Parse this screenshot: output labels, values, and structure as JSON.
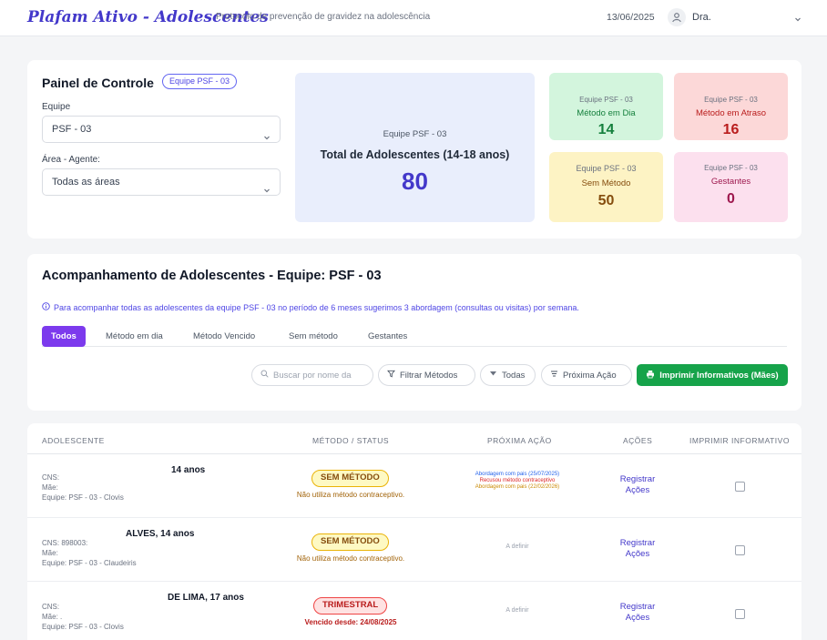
{
  "header": {
    "brand": "Plafam Ativo - Adolescentes",
    "subtitle": "Protocolo de prevenção de gravidez na adolescência",
    "date": "13/06/2025",
    "user": "Dra."
  },
  "control_panel": {
    "title": "Painel de Controle",
    "team_pill": "Equipe PSF - 03",
    "team_label": "Equipe",
    "team_value": "PSF - 03",
    "area_label": "Área - Agente:",
    "area_value": "Todas as áreas",
    "total": {
      "team": "Equipe PSF - 03",
      "label": "Total de Adolescentes (14-18 anos)",
      "value": "80"
    },
    "stats": [
      {
        "team": "Equipe PSF - 03",
        "label": "Método em Dia",
        "value": "14",
        "color": "#15803d"
      },
      {
        "team": "Equipe PSF - 03",
        "label": "Método em Atraso",
        "value": "16",
        "color": "#b91c1c"
      },
      {
        "team": "Equipe PSF - 03",
        "label": "Sem Método",
        "value": "50",
        "color": "#854d0e"
      },
      {
        "team": "Equipe PSF - 03",
        "label": "Gestantes",
        "value": "0",
        "color": "#9d174d"
      }
    ]
  },
  "tracking": {
    "title": "Acompanhamento de Adolescentes - Equipe: PSF - 03",
    "info": "Para acompanhar todas as adolescentes da equipe PSF - 03 no período de 6 meses sugerimos 3 abordagem (consultas ou visitas) por semana.",
    "tabs": [
      "Todos",
      "Método em dia",
      "Método Vencido",
      "Sem método",
      "Gestantes"
    ],
    "search_placeholder": "Buscar por nome da",
    "filter_label": "Filtrar Métodos",
    "all_label": "Todas",
    "next_action_label": "Próxima Ação",
    "print_label": "Imprimir Informativos (Mães)"
  },
  "table": {
    "columns": [
      "ADOLESCENTE",
      "MÉTODO / STATUS",
      "PRÓXIMA AÇÃO",
      "AÇÕES",
      "IMPRIMIR INFORMATIVO"
    ],
    "rows": [
      {
        "name": "14 anos",
        "cns": "CNS:",
        "mae": "Mãe:",
        "equipe": "Equipe: PSF - 03 - Clovis",
        "badge": "SEM MÉTODO",
        "status_text": "Não utiliza método contraceptivo.",
        "next_lines": [
          "Abordagem com pais (25/07/2025)",
          "Recusou método contraceptivo",
          "Abordagem com pais (22/02/2026)"
        ],
        "action": "Registrar Ações"
      },
      {
        "name": "ALVES, 14 anos",
        "cns": "CNS: 898003:",
        "mae": "Mãe:",
        "equipe": "Equipe: PSF - 03 - Claudeiris",
        "badge": "SEM MÉTODO",
        "status_text": "Não utiliza método contraceptivo.",
        "next_text": "A definir",
        "action": "Registrar Ações"
      },
      {
        "name": "DE LIMA, 17 anos",
        "cns": "CNS:",
        "mae": "Mãe: .",
        "equipe": "Equipe: PSF - 03 - Clovis",
        "badge": "TRIMESTRAL",
        "status_text": "Vencido desde: 24/08/2025",
        "next_text": "A definir",
        "action": "Registrar Ações"
      }
    ]
  }
}
